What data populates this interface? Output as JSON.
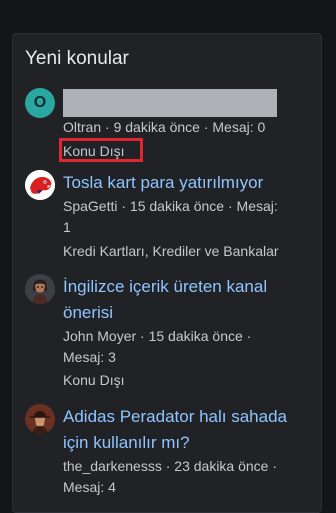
{
  "panel": {
    "title": "Yeni konular"
  },
  "items": [
    {
      "avatar_letter": "O",
      "avatar_color": "#2aa7a1",
      "title_redacted": true,
      "meta": "Oltran · 9 dakika önce · Mesaj: 0",
      "forum": "Konu Dışı"
    },
    {
      "avatar_icon": "red-creature-avatar",
      "title": "Tosla kart para yatırılmıyor",
      "meta_line1": "SpaGetti · 15 dakika önce · Mesaj:",
      "meta_line2": "1",
      "forum": "Kredi Kartları, Krediler ve Bankalar"
    },
    {
      "avatar_icon": "dark-character-avatar",
      "title_line1": "İngilizce içerik üreten kanal",
      "title_line2": "önerisi",
      "meta_line1": "John Moyer · 15 dakika önce ·",
      "meta_line2": "Mesaj: 3",
      "forum": "Konu Dışı"
    },
    {
      "avatar_icon": "cowboy-avatar",
      "title_line1": "Adidas Peradator halı sahada",
      "title_line2": "için kullanılır mı?",
      "meta_line1": "the_darkenesss · 23 dakika önce ·",
      "meta_line2": "Mesaj: 4"
    }
  ],
  "colors": {
    "background": "#141517",
    "panel": "#202226",
    "link": "#8fc4ff",
    "muted": "#c4c8cd",
    "highlight": "#e0262f"
  }
}
